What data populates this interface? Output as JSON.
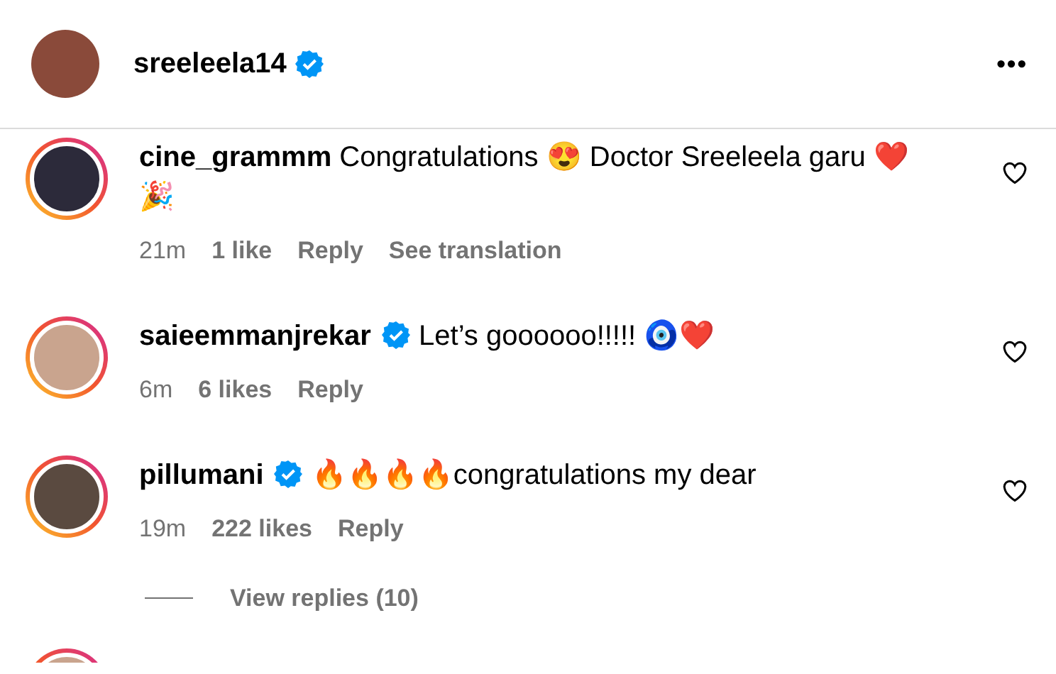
{
  "header": {
    "username": "sreeleela14",
    "verified": true,
    "more": "•••"
  },
  "comments": [
    {
      "username": "cine_grammm",
      "verified": false,
      "text": "Congratulations 😍 Doctor Sreeleela garu ❤️ 🎉",
      "time": "21m",
      "likes": "1 like",
      "reply": "Reply",
      "translation": "See translation",
      "liked": false
    },
    {
      "username": "saieemmanjrekar",
      "verified": true,
      "text": "Let’s goooooo!!!!! 🧿❤️",
      "time": "6m",
      "likes": "6 likes",
      "reply": "Reply",
      "liked": false
    },
    {
      "username": "pillumani",
      "verified": true,
      "text": "🔥🔥🔥🔥congratulations my dear",
      "time": "19m",
      "likes": "222 likes",
      "reply": "Reply",
      "liked": false
    }
  ],
  "view_replies": "View replies (10)"
}
